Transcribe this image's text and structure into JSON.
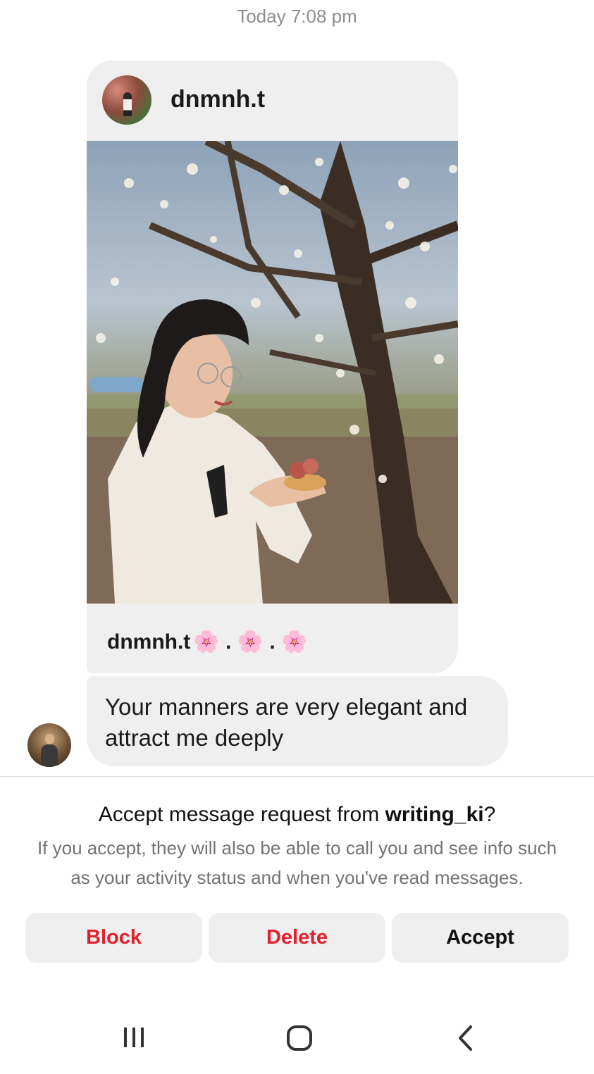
{
  "thread": {
    "timestamp": "Today 7:08 pm"
  },
  "shared_post": {
    "username": "dnmnh.t",
    "caption_username": "dnmnh.t",
    "caption_rest": "🌸 . 🌸 . 🌸",
    "avatar_icon": "profile-avatar"
  },
  "message": {
    "text": "Your manners are very elegant and attract me deeply",
    "sender_avatar_icon": "sender-avatar"
  },
  "request": {
    "title_prefix": "Accept message request from ",
    "title_user": "writing_ki",
    "title_suffix": "?",
    "description": "If you accept, they will also be able to call you and see info such as your activity status and when you've read messages."
  },
  "actions": {
    "block_label": "Block",
    "delete_label": "Delete",
    "accept_label": "Accept",
    "danger_color": "#e0212e"
  },
  "system_nav": {
    "recents_icon": "recents-icon",
    "home_icon": "home-icon",
    "back_icon": "back-icon"
  }
}
